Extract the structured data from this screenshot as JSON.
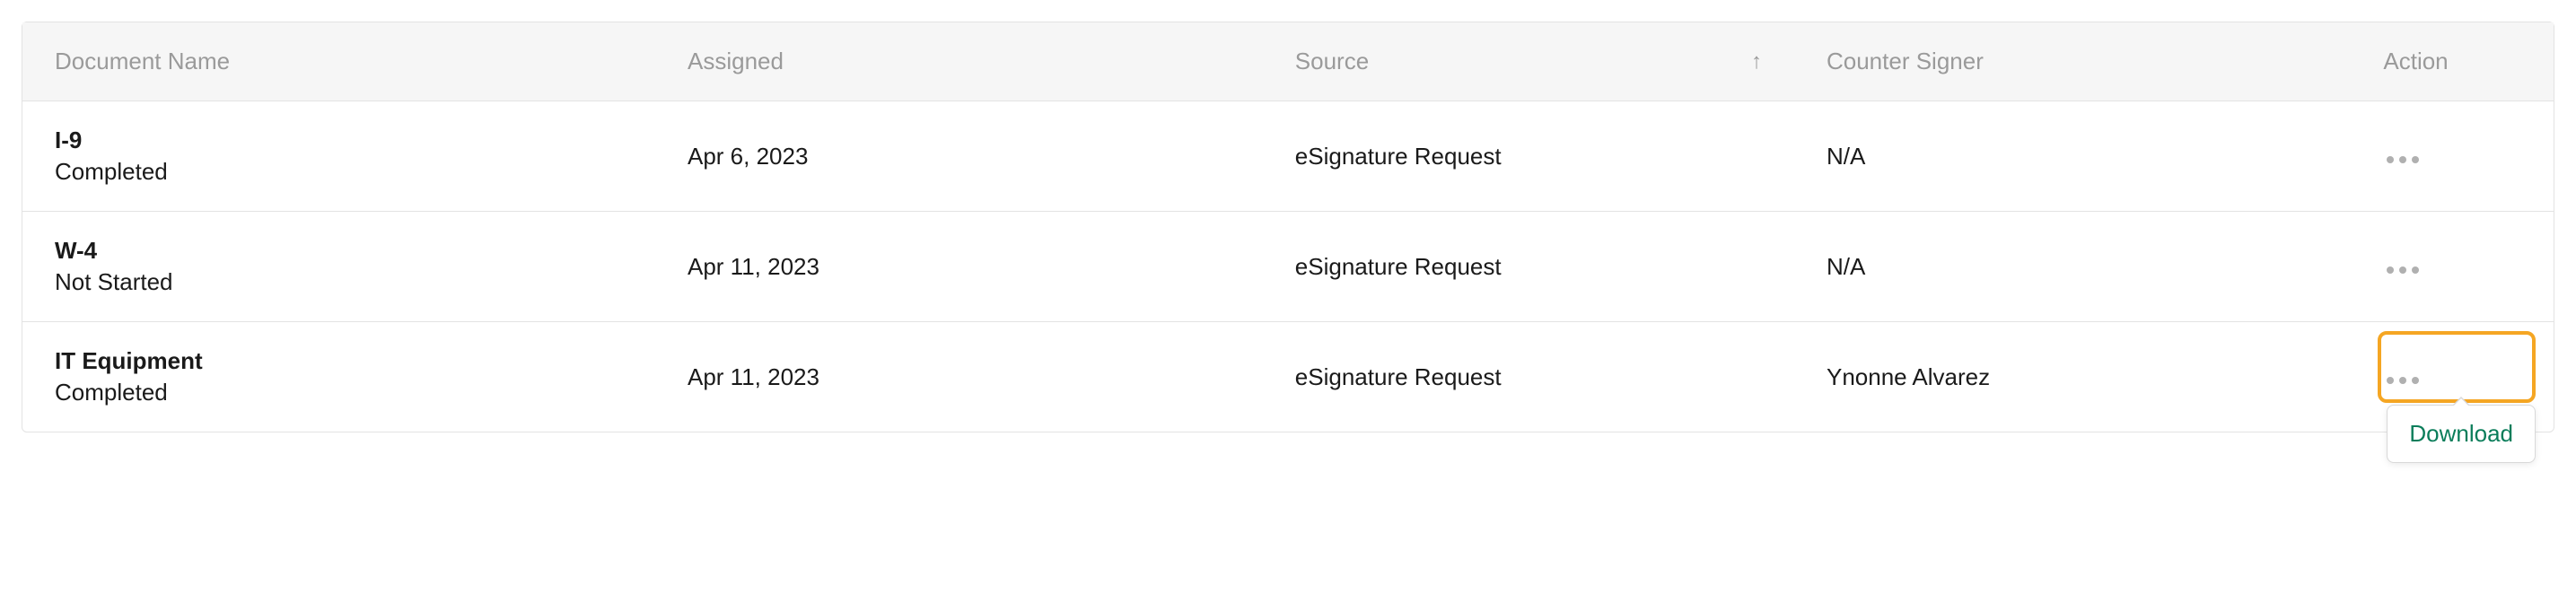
{
  "table": {
    "headers": {
      "document_name": "Document Name",
      "assigned": "Assigned",
      "source": "Source",
      "counter_signer": "Counter Signer",
      "action": "Action"
    },
    "rows": [
      {
        "name": "I-9",
        "status": "Completed",
        "assigned": "Apr 6, 2023",
        "source": "eSignature Request",
        "counter_signer": "N/A"
      },
      {
        "name": "W-4",
        "status": "Not Started",
        "assigned": "Apr 11, 2023",
        "source": "eSignature Request",
        "counter_signer": "N/A"
      },
      {
        "name": "IT Equipment",
        "status": "Completed",
        "assigned": "Apr 11, 2023",
        "source": "eSignature Request",
        "counter_signer": "Ynonne Alvarez"
      }
    ]
  },
  "dropdown": {
    "download": "Download"
  }
}
